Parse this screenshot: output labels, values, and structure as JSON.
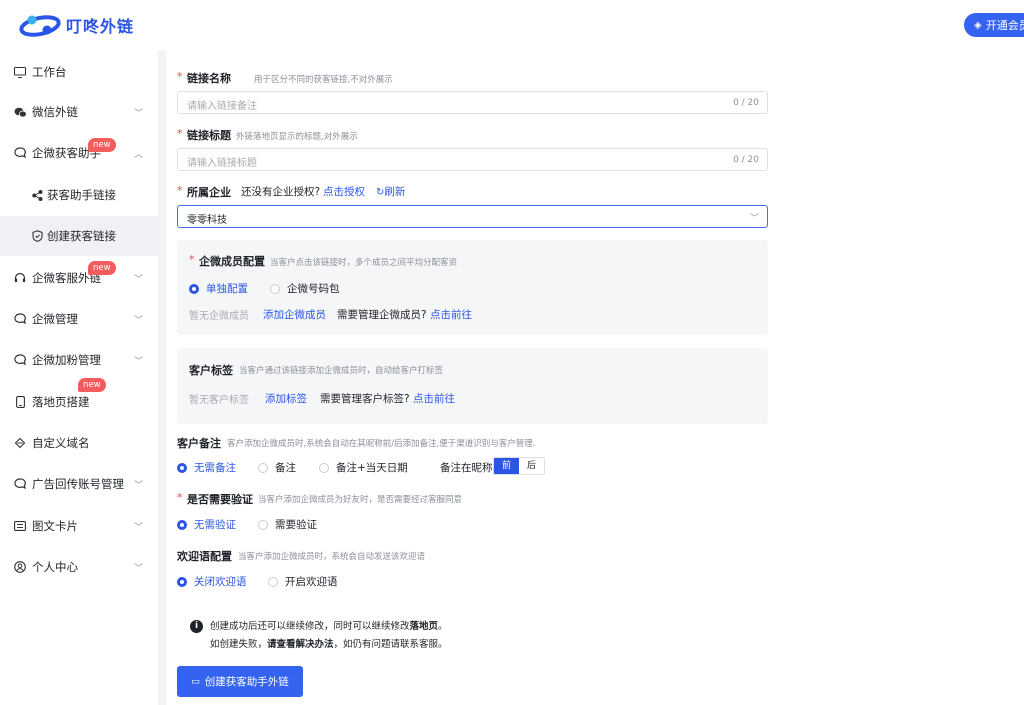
{
  "header": {
    "logo_text": "叮咚外链",
    "vip_button": "开通会员",
    "brand_color": "#2b55e6"
  },
  "sidebar": {
    "items": [
      {
        "label": "工作台",
        "icon": "monitor-icon"
      },
      {
        "label": "微信外链",
        "icon": "wechat-icon"
      },
      {
        "label": "企微获客助手",
        "icon": "chat-icon",
        "badge": "new"
      },
      {
        "label": "获客助手链接",
        "icon": "share-icon"
      },
      {
        "label": "创建获客链接",
        "icon": "shield-icon"
      },
      {
        "label": "企微客服外链",
        "icon": "headset-icon",
        "badge": "new"
      },
      {
        "label": "企微管理",
        "icon": "chat-icon"
      },
      {
        "label": "企微加粉管理",
        "icon": "chat-icon"
      },
      {
        "label": "落地页搭建",
        "icon": "phone-icon",
        "badge": "new"
      },
      {
        "label": "自定义域名",
        "icon": "link-icon"
      },
      {
        "label": "广告回传账号管理",
        "icon": "chat-icon"
      },
      {
        "label": "图文卡片",
        "icon": "card-icon"
      },
      {
        "label": "个人中心",
        "icon": "user-icon"
      }
    ]
  },
  "form": {
    "link_name": {
      "label": "链接名称",
      "hint": "用于区分不同的获客链接,不对外展示",
      "placeholder": "请输入链接备注",
      "counter": "0 / 20"
    },
    "link_title": {
      "label": "链接标题",
      "hint": "外链落地页显示的标题,对外展示",
      "placeholder": "请输入链接标题",
      "counter": "0 / 20"
    },
    "company": {
      "label": "所属企业",
      "no_auth_text": "还没有企业授权?",
      "auth_link": "点击授权",
      "refresh": "刷新",
      "selected": "零零科技"
    },
    "members": {
      "label": "企微成员配置",
      "hint": "当客户点击该链接时，多个成员之间平均分配客资",
      "options": [
        "单独配置",
        "企微号码包"
      ],
      "selected": 0,
      "empty": "暂无企微成员",
      "add_link": "添加企微成员",
      "manage_text": "需要管理企微成员?",
      "manage_link": "点击前往"
    },
    "tags": {
      "label": "客户标签",
      "hint": "当客户通过该链接添加企微成员时，自动给客户打标签",
      "empty": "暂无客户标签",
      "add_link": "添加标签",
      "manage_text": "需要管理客户标签?",
      "manage_link": "点击前往"
    },
    "remark": {
      "label": "客户备注",
      "hint": "客户添加企微成员时,系统会自动在其昵称前/后添加备注,便于渠道识别与客户管理.",
      "options": [
        "无需备注",
        "备注",
        "备注+当天日期"
      ],
      "selected": 0,
      "position_label": "备注在昵称",
      "position_options": [
        "前",
        "后"
      ],
      "position_selected": 0
    },
    "verify": {
      "label": "是否需要验证",
      "hint": "当客户添加企微成员为好友时，是否需要经过客服同意",
      "options": [
        "无需验证",
        "需要验证"
      ],
      "selected": 0
    },
    "welcome": {
      "label": "欢迎语配置",
      "hint": "当客户添加企微成员时，系统会自动发送该欢迎语",
      "options": [
        "关闭欢迎语",
        "开启欢迎语"
      ],
      "selected": 0
    },
    "notice": {
      "line1_a": "创建成功后还可以继续修改，同时可以继续修改",
      "line1_b": "落地页",
      "line1_c": "。",
      "line2_a": "如创建失败，",
      "line2_b": "请查看解决办法",
      "line2_c": "，如仍有问题请联系客服。"
    },
    "submit": "创建获客助手外链"
  }
}
